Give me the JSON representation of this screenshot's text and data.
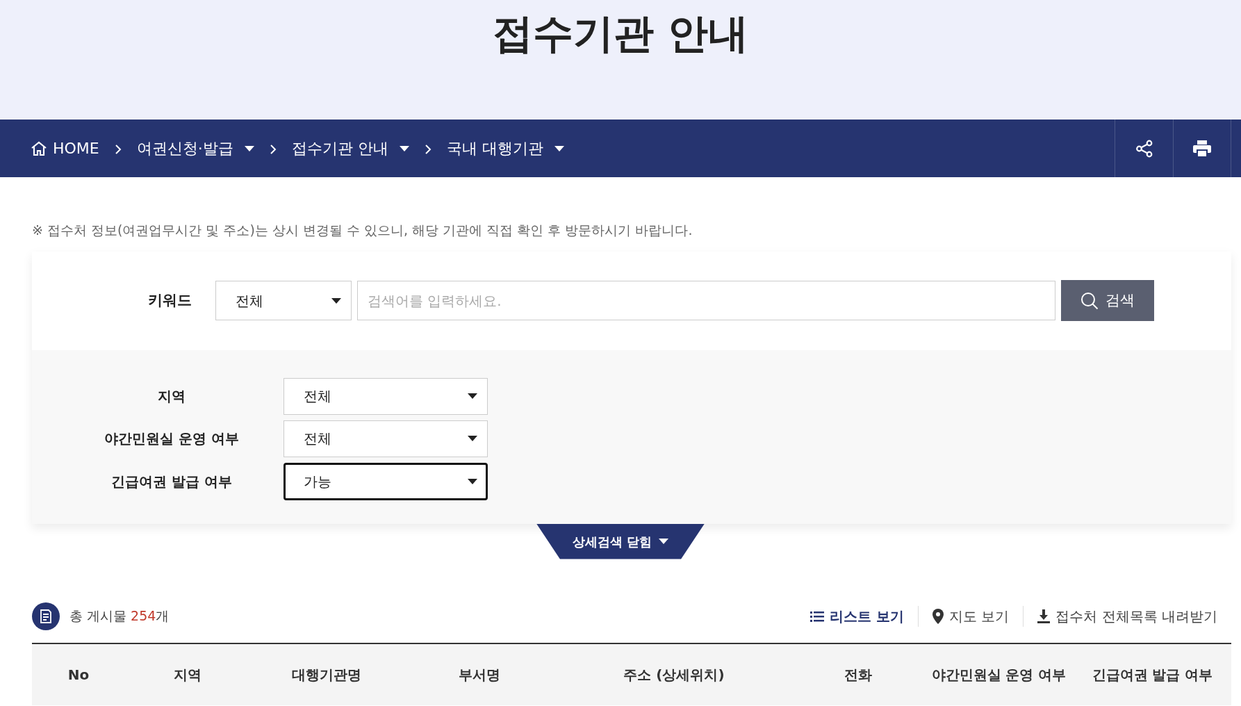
{
  "page_title": "접수기관 안내",
  "breadcrumb": [
    {
      "label": "HOME",
      "kind": "home"
    },
    {
      "label": "여권신청·발급",
      "kind": "dropdown"
    },
    {
      "label": "접수기관 안내",
      "kind": "dropdown"
    },
    {
      "label": "국내 대행기관",
      "kind": "dropdown"
    }
  ],
  "notice": "※ 접수처 정보(여권업무시간 및 주소)는 상시 변경될 수 있으니, 해당 기관에 직접 확인 후 방문하시기 바랍니다.",
  "keyword": {
    "label": "키워드",
    "scope": "전체",
    "placeholder": "검색어를 입력하세요.",
    "button": "검색"
  },
  "filters": [
    {
      "label": "지역",
      "value": "전체",
      "focused": false
    },
    {
      "label": "야간민원실 운영 여부",
      "value": "전체",
      "focused": false
    },
    {
      "label": "긴급여권 발급 여부",
      "value": "가능",
      "focused": true
    }
  ],
  "detail_toggle": "상세검색 닫힘",
  "total": {
    "prefix": "총 게시물 ",
    "count": "254",
    "suffix": "개"
  },
  "views": [
    {
      "label": "리스트 보기",
      "kind": "list",
      "selected": true
    },
    {
      "label": "지도 보기",
      "kind": "map",
      "selected": false
    },
    {
      "label": "접수처 전체목록 내려받기",
      "kind": "download",
      "selected": false
    }
  ],
  "table": {
    "columns": [
      "No",
      "지역",
      "대행기관명",
      "부서명",
      "주소 (상세위치)",
      "전화",
      "야간민원실 운영 여부",
      "긴급여권 발급 여부"
    ]
  }
}
